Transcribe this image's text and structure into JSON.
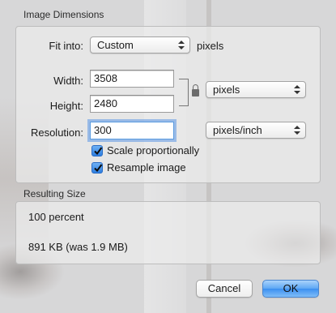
{
  "image_dimensions": {
    "section_label": "Image Dimensions",
    "fit_into": {
      "label": "Fit into:",
      "value": "Custom",
      "unit": "pixels"
    },
    "width": {
      "label": "Width:",
      "value": "3508"
    },
    "height": {
      "label": "Height:",
      "value": "2480"
    },
    "size_unit": "pixels",
    "resolution": {
      "label": "Resolution:",
      "value": "300",
      "unit": "pixels/inch"
    },
    "scale_proportionally": {
      "label": "Scale proportionally",
      "checked": true
    },
    "resample_image": {
      "label": "Resample image",
      "checked": true
    }
  },
  "resulting_size": {
    "section_label": "Resulting Size",
    "percent": "100 percent",
    "file_size": "891 KB (was 1.9 MB)"
  },
  "buttons": {
    "cancel": "Cancel",
    "ok": "OK"
  },
  "icons": {
    "lock": "lock-icon",
    "check": "checkmark-icon",
    "popup_arrows": "up-down-arrows-icon"
  },
  "colors": {
    "accent": "#3b8ff0",
    "focus_ring": "#5a9be0"
  }
}
